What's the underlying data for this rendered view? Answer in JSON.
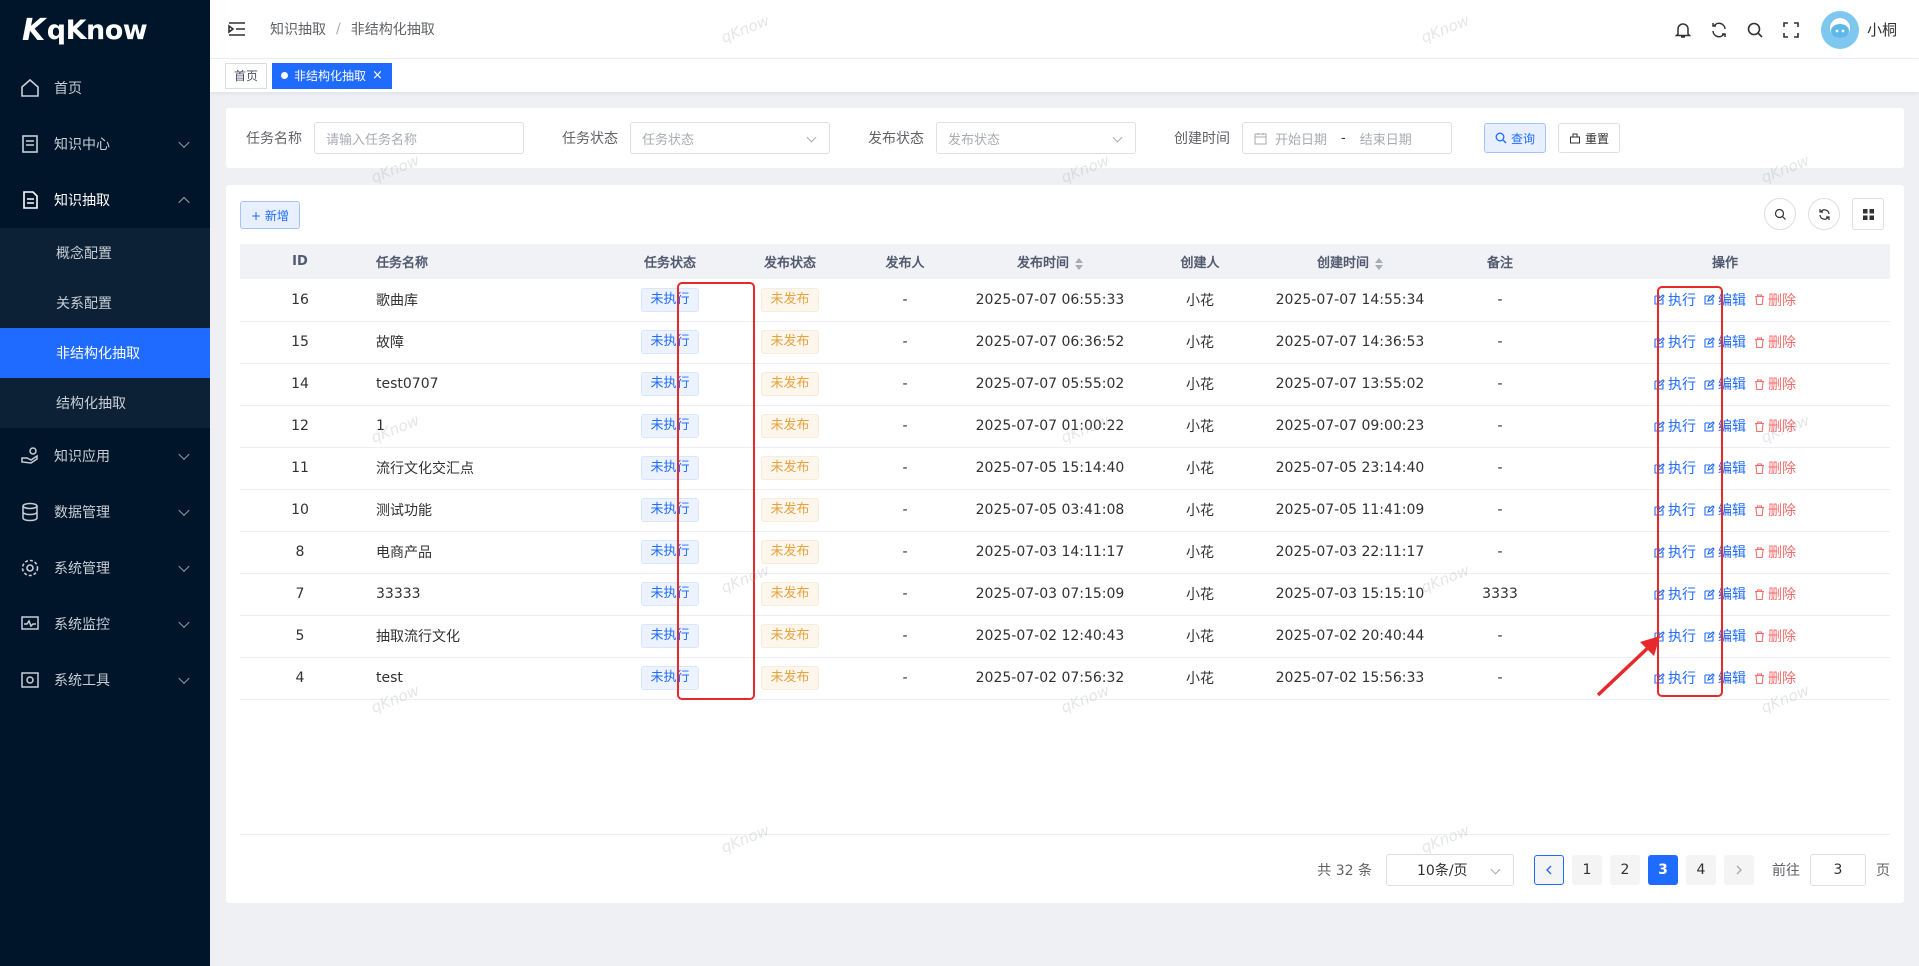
{
  "brand": {
    "name": "qKnow"
  },
  "sidebar": {
    "items": [
      {
        "label": "首页",
        "icon": "home-icon",
        "expandable": false
      },
      {
        "label": "知识中心",
        "icon": "book-icon",
        "expandable": true
      },
      {
        "label": "知识抽取",
        "icon": "document-icon",
        "expandable": true,
        "open": true,
        "children": [
          {
            "label": "概念配置"
          },
          {
            "label": "关系配置"
          },
          {
            "label": "非结构化抽取",
            "active": true
          },
          {
            "label": "结构化抽取"
          }
        ]
      },
      {
        "label": "知识应用",
        "icon": "hand-icon",
        "expandable": true
      },
      {
        "label": "数据管理",
        "icon": "database-icon",
        "expandable": true
      },
      {
        "label": "系统管理",
        "icon": "gear-icon",
        "expandable": true
      },
      {
        "label": "系统监控",
        "icon": "monitor-icon",
        "expandable": true
      },
      {
        "label": "系统工具",
        "icon": "tool-icon",
        "expandable": true
      }
    ]
  },
  "header": {
    "breadcrumb": [
      "知识抽取",
      "非结构化抽取"
    ],
    "separator": "/",
    "username": "小桐",
    "icons": [
      "bell-icon",
      "refresh-icon",
      "search-icon",
      "fullscreen-icon"
    ]
  },
  "tags": [
    {
      "label": "首页",
      "active": false
    },
    {
      "label": "非结构化抽取",
      "active": true,
      "close": "×"
    }
  ],
  "search": {
    "task_name_label": "任务名称",
    "task_name_placeholder": "请输入任务名称",
    "task_status_label": "任务状态",
    "task_status_placeholder": "任务状态",
    "publish_status_label": "发布状态",
    "publish_status_placeholder": "发布状态",
    "create_time_label": "创建时间",
    "start_placeholder": "开始日期",
    "range_sep": "-",
    "end_placeholder": "结束日期",
    "query_label": "查询",
    "reset_label": "重置"
  },
  "toolbar": {
    "add_label": "+ 新增"
  },
  "table": {
    "columns": [
      "ID",
      "任务名称",
      "任务状态",
      "发布状态",
      "发布人",
      "发布时间",
      "创建人",
      "创建时间",
      "备注",
      "操作"
    ],
    "rows": [
      {
        "id": "16",
        "name": "歌曲库",
        "status": "未执行",
        "publish": "未发布",
        "publisher": "-",
        "publish_time": "2025-07-07 06:55:33",
        "creator": "小花",
        "create_time": "2025-07-07 14:55:34",
        "remark": "-"
      },
      {
        "id": "15",
        "name": "故障",
        "status": "未执行",
        "publish": "未发布",
        "publisher": "-",
        "publish_time": "2025-07-07 06:36:52",
        "creator": "小花",
        "create_time": "2025-07-07 14:36:53",
        "remark": "-"
      },
      {
        "id": "14",
        "name": "test0707",
        "status": "未执行",
        "publish": "未发布",
        "publisher": "-",
        "publish_time": "2025-07-07 05:55:02",
        "creator": "小花",
        "create_time": "2025-07-07 13:55:02",
        "remark": "-"
      },
      {
        "id": "12",
        "name": "1",
        "status": "未执行",
        "publish": "未发布",
        "publisher": "-",
        "publish_time": "2025-07-07 01:00:22",
        "creator": "小花",
        "create_time": "2025-07-07 09:00:23",
        "remark": "-"
      },
      {
        "id": "11",
        "name": "流行文化交汇点",
        "status": "未执行",
        "publish": "未发布",
        "publisher": "-",
        "publish_time": "2025-07-05 15:14:40",
        "creator": "小花",
        "create_time": "2025-07-05 23:14:40",
        "remark": "-"
      },
      {
        "id": "10",
        "name": "测试功能",
        "status": "未执行",
        "publish": "未发布",
        "publisher": "-",
        "publish_time": "2025-07-05 03:41:08",
        "creator": "小花",
        "create_time": "2025-07-05 11:41:09",
        "remark": "-"
      },
      {
        "id": "8",
        "name": "电商产品",
        "status": "未执行",
        "publish": "未发布",
        "publisher": "-",
        "publish_time": "2025-07-03 14:11:17",
        "creator": "小花",
        "create_time": "2025-07-03 22:11:17",
        "remark": "-"
      },
      {
        "id": "7",
        "name": "33333",
        "status": "未执行",
        "publish": "未发布",
        "publisher": "-",
        "publish_time": "2025-07-03 07:15:09",
        "creator": "小花",
        "create_time": "2025-07-03 15:15:10",
        "remark": "3333"
      },
      {
        "id": "5",
        "name": "抽取流行文化",
        "status": "未执行",
        "publish": "未发布",
        "publisher": "-",
        "publish_time": "2025-07-02 12:40:43",
        "creator": "小花",
        "create_time": "2025-07-02 20:40:44",
        "remark": "-"
      },
      {
        "id": "4",
        "name": "test",
        "status": "未执行",
        "publish": "未发布",
        "publisher": "-",
        "publish_time": "2025-07-02 07:56:32",
        "creator": "小花",
        "create_time": "2025-07-02 15:56:33",
        "remark": "-"
      }
    ],
    "actions": {
      "execute": "执行",
      "edit": "编辑",
      "delete": "删除"
    }
  },
  "pagination": {
    "total_text": "共 32 条",
    "page_size": "10条/页",
    "pages": [
      "1",
      "2",
      "3",
      "4"
    ],
    "current": "3",
    "goto_label": "前往",
    "goto_value": "3",
    "page_suffix": "页"
  },
  "watermark": "qKnow",
  "colors": {
    "primary": "#1f6bff",
    "sidebar_bg": "#001529",
    "danger": "#f56c6c",
    "warning": "#e6a23c",
    "highlight": "#e8292b"
  }
}
